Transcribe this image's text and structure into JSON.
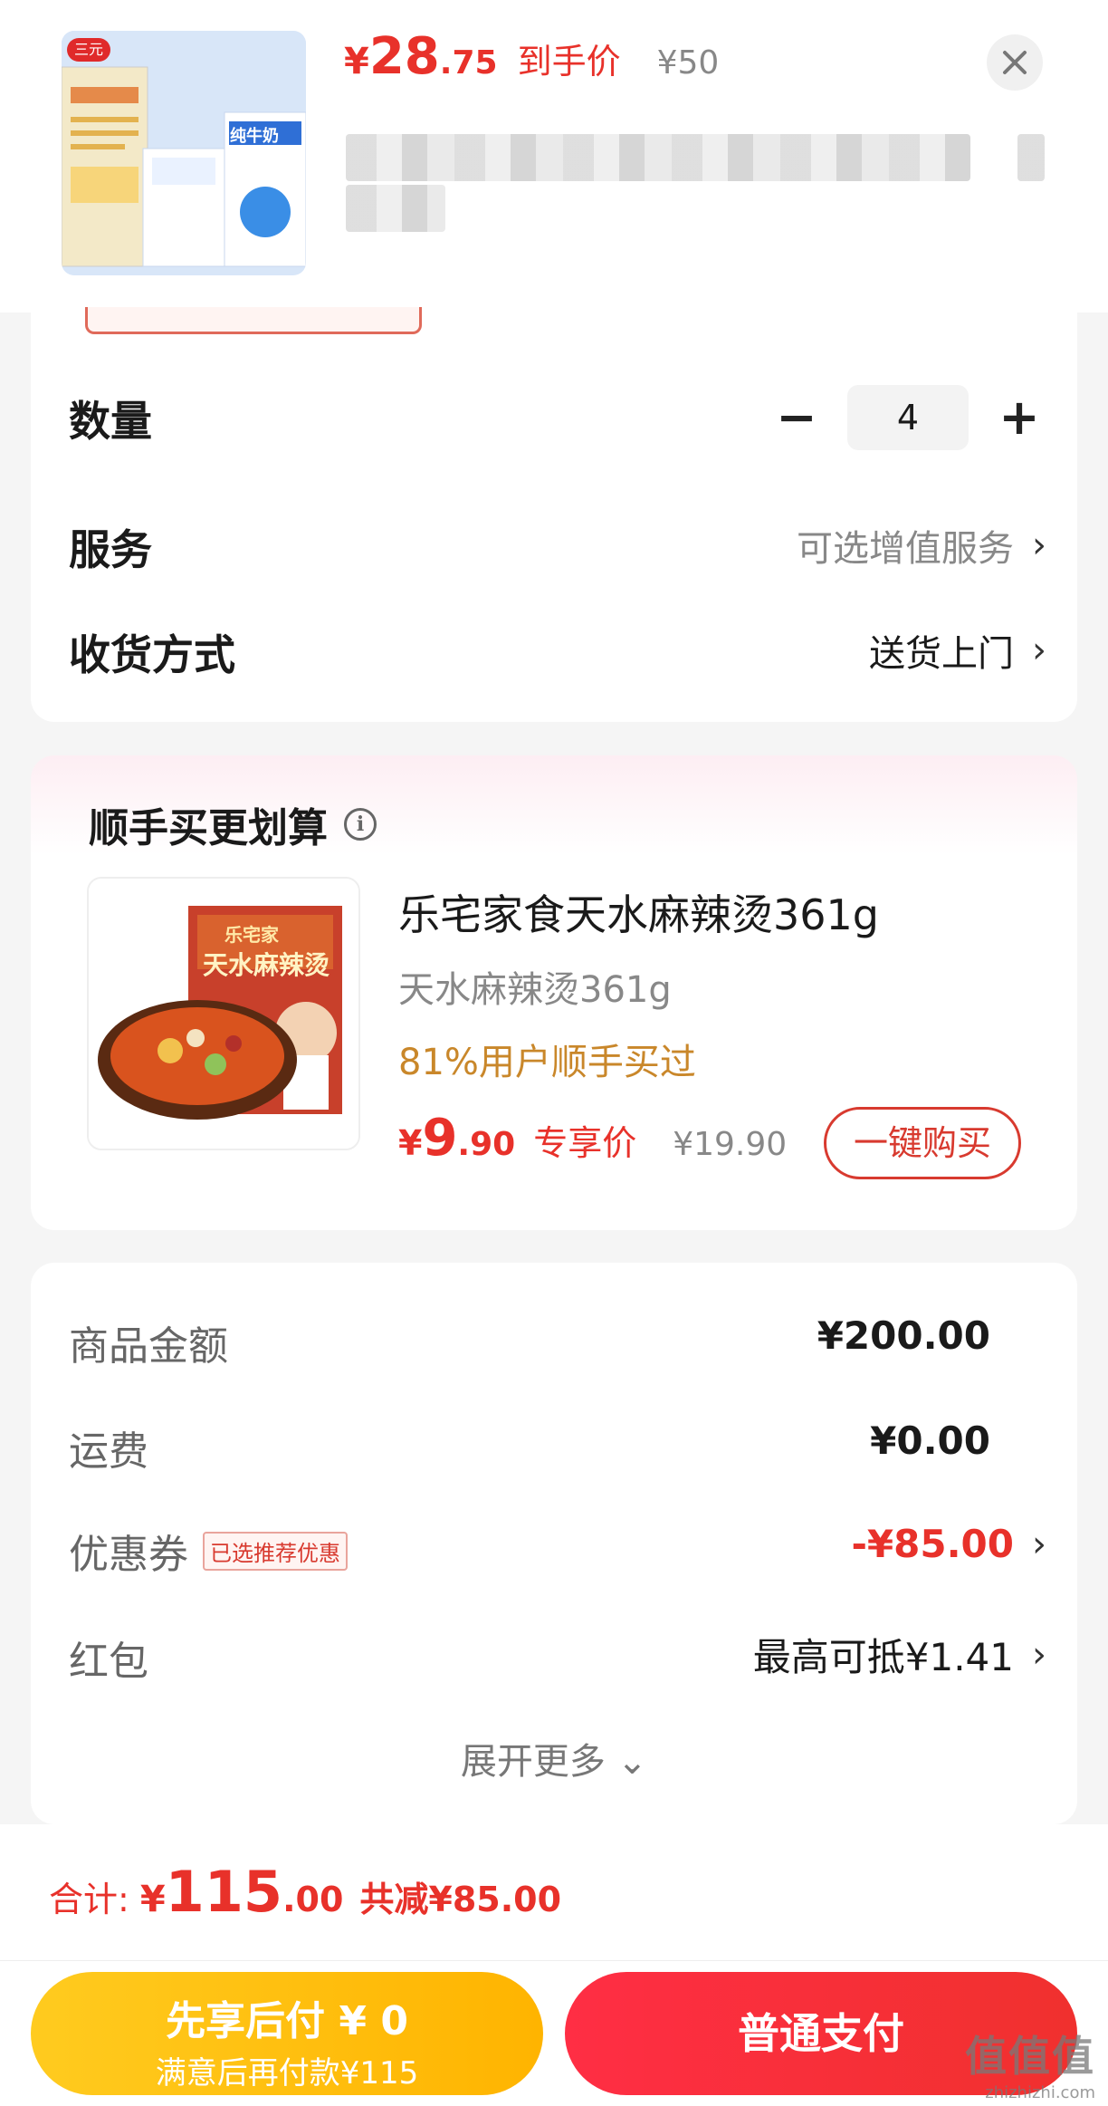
{
  "header": {
    "thumbnail_brand": "三元",
    "thumbnail_product": "纯牛奶",
    "price_yen": "¥",
    "price_int": "28",
    "price_dec": ".75",
    "price_tag": "到手价",
    "original_price": "¥50"
  },
  "options": {
    "quantity_label": "数量",
    "quantity_minus": "−",
    "quantity_value": "4",
    "quantity_plus": "+",
    "service_label": "服务",
    "service_value": "可选增值服务",
    "delivery_label": "收货方式",
    "delivery_value": "送货上门",
    "chevron": "›"
  },
  "addon": {
    "title": "顺手买更划算",
    "info_glyph": "i",
    "image_brand": "乐宅家",
    "image_title": "天水麻辣烫",
    "name": "乐宅家食天水麻辣烫361g",
    "spec": "天水麻辣烫361g",
    "note": "81%用户顺手买过",
    "price_yen": "¥",
    "price_int": "9",
    "price_dec": ".90",
    "price_tag": "专享价",
    "original_price": "¥19.90",
    "buy_button": "一键购买"
  },
  "summary": {
    "goods_label": "商品金额",
    "goods_value": "¥200.00",
    "shipping_label": "运费",
    "shipping_value": "¥0.00",
    "coupon_label": "优惠券",
    "coupon_tag": "已选推荐优惠",
    "coupon_value": "-¥85.00",
    "redpacket_label": "红包",
    "redpacket_value": "最高可抵¥1.41",
    "expand": "展开更多 ⌄"
  },
  "footer": {
    "total_label": "合计:",
    "total_yen": "¥",
    "total_int": "115",
    "total_dec": ".00",
    "total_saving": "共减¥85.00",
    "pay_later_title": "先享后付 ¥ 0",
    "pay_later_sub": "满意后再付款¥115",
    "pay_button": "普通支付",
    "watermark_text": "值值值",
    "watermark_url": "zhizhizhi.com"
  },
  "colors": {
    "accent_red": "#e8312a",
    "note_orange": "#c9872a",
    "pay_later_yellow": "#ffb400"
  }
}
